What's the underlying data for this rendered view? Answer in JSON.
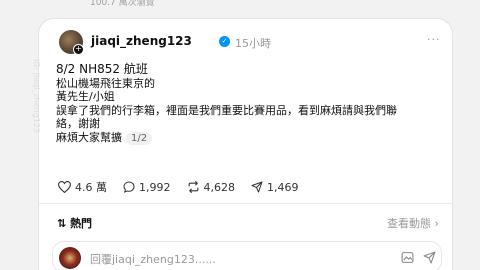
{
  "page": {
    "top_views": "100.7 萬次瀏覽"
  },
  "post": {
    "username": "jiaqi_zheng123",
    "time": "15小時",
    "more_label": "···",
    "lines": [
      "8/2 NH852 航班",
      "松山機場飛往東京的",
      "黃先生/小姐",
      "誤拿了我們的行李箱，裡面是我們重要比賽用品，看到麻煩請與我們聯",
      "絡，謝謝",
      "麻煩大家幫擴"
    ],
    "page_indicator": "1/2",
    "watermark": "IG: jiaqi_zheng123"
  },
  "actions": {
    "likes": "4.6 萬",
    "comments": "1,992",
    "reposts": "4,628",
    "shares": "1,469"
  },
  "comments_section": {
    "sort_label": "熱門",
    "activity_label": "查看動態",
    "reply_placeholder": "回覆jiaqi_zheng123......"
  },
  "colors": {
    "verified": "#0095f6",
    "card_bg": "#ffffff",
    "page_bg": "#f2f2f2"
  }
}
